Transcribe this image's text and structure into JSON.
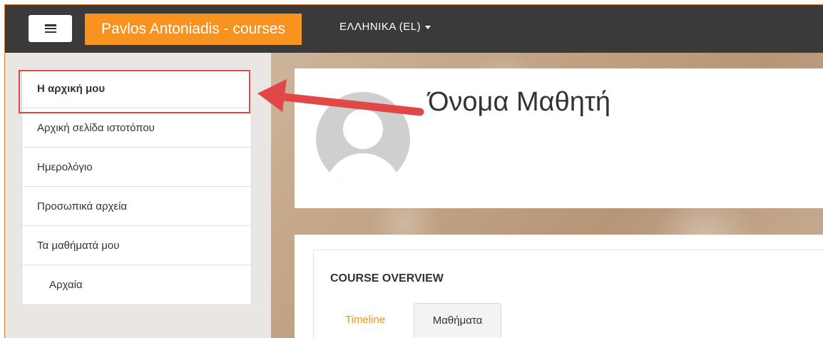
{
  "navbar": {
    "brand": "Pavlos Antoniadis - courses",
    "language": "ΕΛΛΗΝΙΚΑ (EL)",
    "menu_icon": "hamburger-menu-icon",
    "brand_color": "#f7931e",
    "bar_color": "#3a3a3a"
  },
  "sidebar": {
    "items": [
      {
        "label": "Η αρχική μου",
        "active": true
      },
      {
        "label": "Αρχική σελίδα ιστοτόπου"
      },
      {
        "label": "Ημερολόγιο"
      },
      {
        "label": "Προσωπικά αρχεία"
      },
      {
        "label": "Τα μαθήματά μου"
      },
      {
        "label": "Αρχαία",
        "indent": true
      }
    ]
  },
  "profile": {
    "name": "Όνομα Μαθητή",
    "avatar_icon": "default-user-avatar-icon"
  },
  "annotation": {
    "highlight_color": "#e04848"
  },
  "overview": {
    "title": "COURSE OVERVIEW",
    "tabs": [
      {
        "label": "Timeline"
      },
      {
        "label": "Μαθήματα",
        "active": true
      }
    ]
  }
}
